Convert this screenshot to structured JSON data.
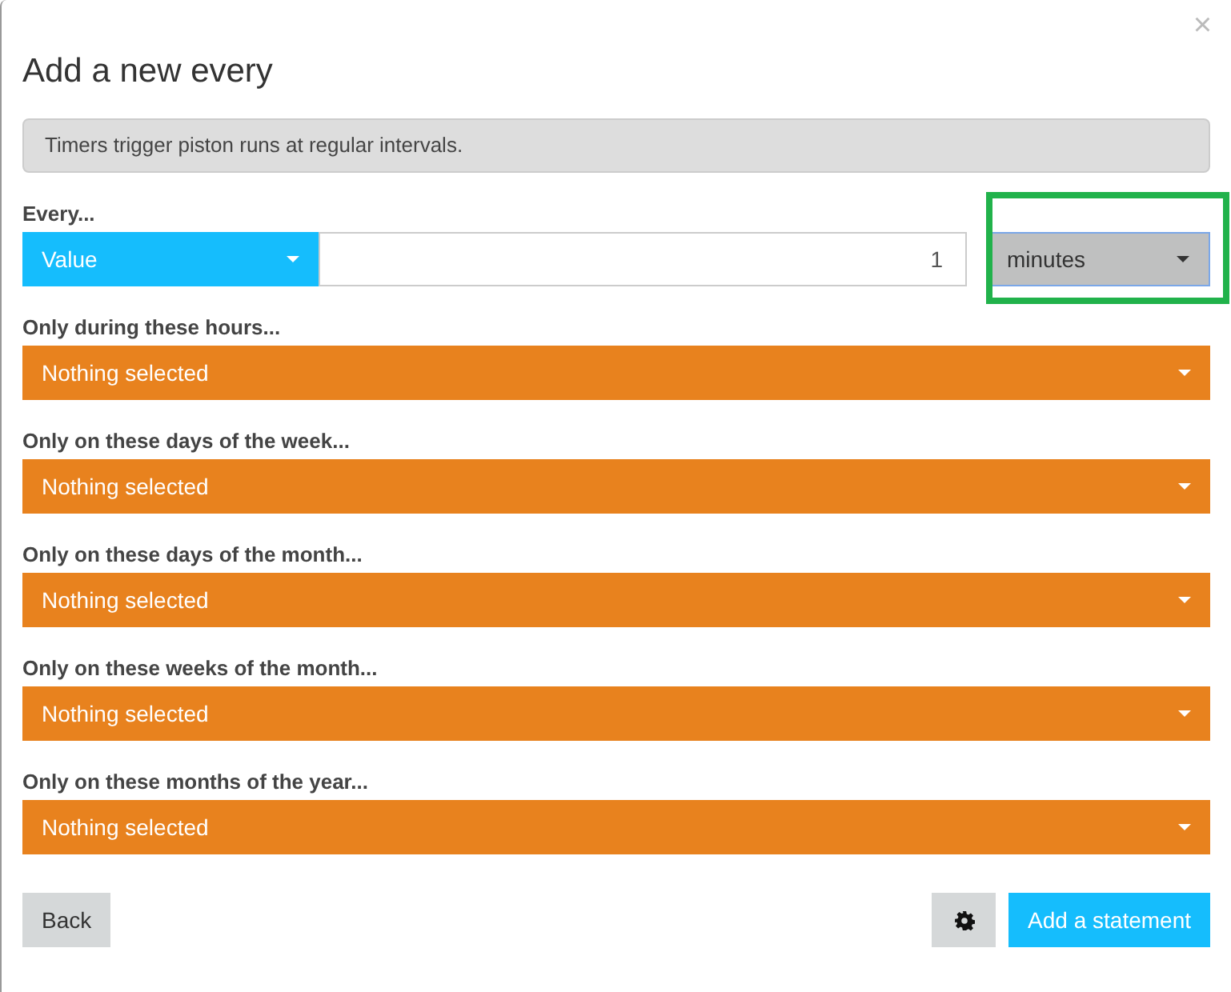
{
  "dialog": {
    "title": "Add a new every",
    "close": "×"
  },
  "info": "Timers trigger piston runs at regular intervals.",
  "every": {
    "label": "Every...",
    "type_dropdown": "Value",
    "value": "1",
    "unit": "minutes",
    "unit_highlighted": true
  },
  "filters": [
    {
      "label": "Only during these hours...",
      "value": "Nothing selected"
    },
    {
      "label": "Only on these days of the week...",
      "value": "Nothing selected"
    },
    {
      "label": "Only on these days of the month...",
      "value": "Nothing selected"
    },
    {
      "label": "Only on these weeks of the month...",
      "value": "Nothing selected"
    },
    {
      "label": "Only on these months of the year...",
      "value": "Nothing selected"
    }
  ],
  "footer": {
    "back": "Back",
    "add": "Add a statement"
  }
}
